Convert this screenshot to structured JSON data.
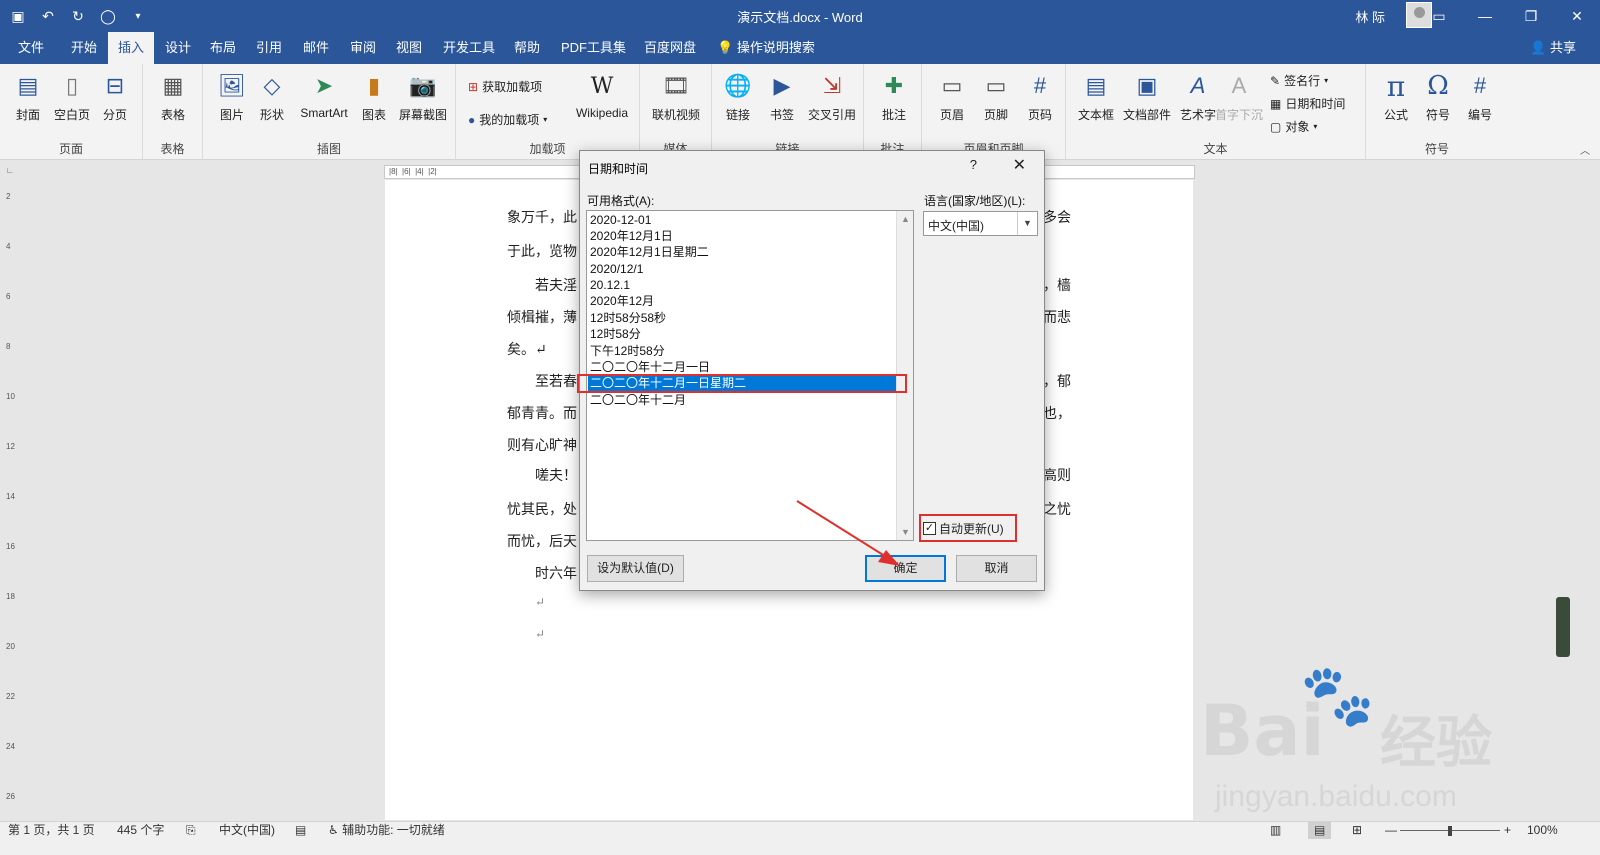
{
  "titlebar": {
    "title": "演示文档.docx - Word",
    "user": "林 际"
  },
  "tabs": [
    "文件",
    "开始",
    "插入",
    "设计",
    "布局",
    "引用",
    "邮件",
    "审阅",
    "视图",
    "开发工具",
    "帮助",
    "PDF工具集",
    "百度网盘"
  ],
  "tellme": "操作说明搜索",
  "share": "共享",
  "ribbon": {
    "pages": {
      "label": "页面",
      "cover": "封面",
      "blank": "空白页",
      "pagebreak": "分页"
    },
    "tables": {
      "label": "表格",
      "table": "表格"
    },
    "illustrations": {
      "label": "插图",
      "picture": "图片",
      "shapes": "形状",
      "smartart": "SmartArt",
      "chart": "图表",
      "screenshot": "屏幕截图"
    },
    "addins": {
      "label": "加载项",
      "get": "获取加载项",
      "my": "我的加载项",
      "wiki": "Wikipedia"
    },
    "media": {
      "label": "媒体",
      "video": "联机视频"
    },
    "links": {
      "label": "链接",
      "link": "链接",
      "bookmark": "书签",
      "crossref": "交叉引用"
    },
    "comments": {
      "label": "批注",
      "comment": "批注"
    },
    "headerfooter": {
      "label": "页眉和页脚",
      "header": "页眉",
      "footer": "页脚",
      "pagenum": "页码"
    },
    "text": {
      "label": "文本",
      "textbox": "文本框",
      "quickparts": "文档部件",
      "wordart": "艺术字",
      "dropcap": "首字下沉",
      "sigline": "签名行",
      "datetime": "日期和时间",
      "object": "对象"
    },
    "symbols": {
      "label": "符号",
      "equation": "公式",
      "symbol": "符号",
      "number": "编号"
    }
  },
  "doc_lines": [
    "象万千，此",
    "于此，览物",
    "若夫淫",
    "倾楫摧，薄",
    "矣。↵",
    "至若春",
    "郁青青。而",
    "则有心旷神",
    "嗟夫！",
    "忧其民，处",
    "而忧，后天",
    "时六年",
    "↵",
    "↵"
  ],
  "doc_right": [
    "多会",
    "，樯",
    "而悲",
    "，郁",
    "也，",
    "高则",
    "之忧"
  ],
  "dialog": {
    "title": "日期和时间",
    "help": "?",
    "available_label": "可用格式(A):",
    "language_label": "语言(国家/地区)(L):",
    "language_value": "中文(中国)",
    "formats": [
      "2020-12-01",
      "2020年12月1日",
      "2020年12月1日星期二",
      "2020/12/1",
      "20.12.1",
      "2020年12月",
      "12时58分58秒",
      "12时58分",
      "下午12时58分",
      "二〇二〇年十二月一日",
      "二〇二〇年十二月一日星期二",
      "二〇二〇年十二月"
    ],
    "selected_index": 10,
    "auto_update": "自动更新(U)",
    "set_default": "设为默认值(D)",
    "ok": "确定",
    "cancel": "取消"
  },
  "status": {
    "page": "第 1 页，共 1 页",
    "words": "445 个字",
    "lang": "中文(中国)",
    "accessibility": "辅助功能: 一切就绪",
    "zoom": "100%"
  },
  "watermark": {
    "brand": "Bai",
    "brand2": "经验",
    "url": "jingyan.baidu.com"
  }
}
